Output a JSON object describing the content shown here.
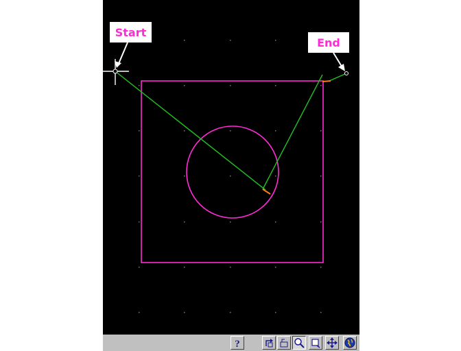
{
  "callouts": {
    "start_label": "Start",
    "end_label": "End"
  },
  "colors": {
    "background": "#000000",
    "geometry": "#ff2bd6",
    "toolpath": "#22c322",
    "lead": "#ff7a1a",
    "grid_dot": "#7a7a7a",
    "callout_text": "#ff2bd6",
    "toolbar": "#c0c0c0"
  },
  "toolbar": {
    "buttons": [
      {
        "icon": "help-icon"
      },
      {
        "icon": "redraw-icon"
      },
      {
        "icon": "zoom-previous-icon"
      },
      {
        "icon": "zoom-icon",
        "pressed": true
      },
      {
        "icon": "zoom-window-icon"
      },
      {
        "icon": "pan-icon"
      },
      {
        "icon": "globe-icon"
      }
    ]
  }
}
